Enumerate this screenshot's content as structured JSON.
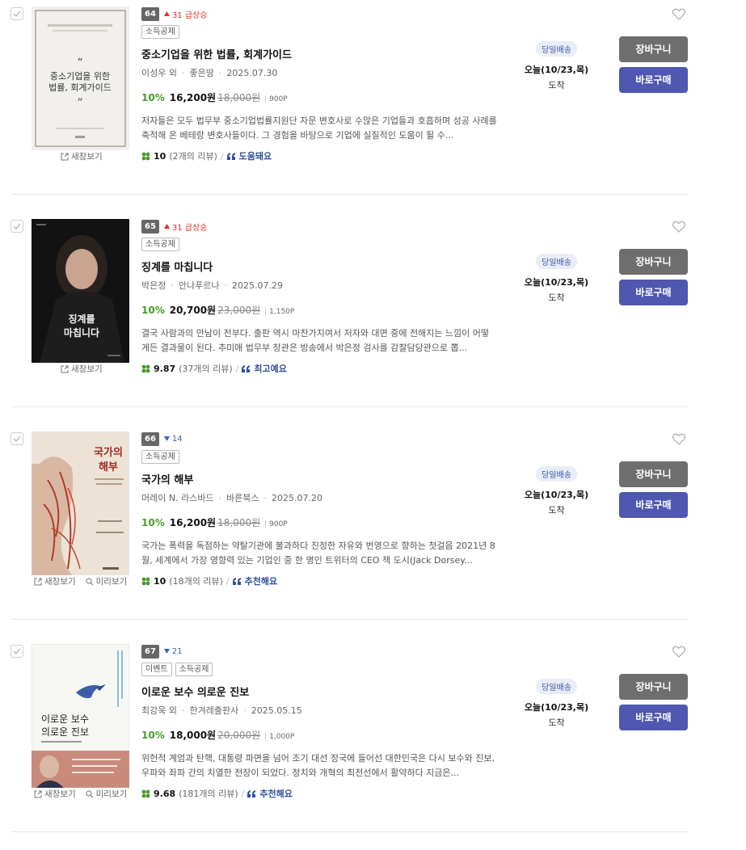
{
  "preview_label": "새창보기",
  "lookinside_label": "미리보기",
  "shipping_badge": "당일배송",
  "delivery_day": "오늘(10/23,목)",
  "delivery_arrive": "도착",
  "cart_label": "장바구니",
  "buy_label": "바로구매",
  "books": [
    {
      "rank": "64",
      "trend": "31 급상승",
      "tags": [
        "소득공제"
      ],
      "title": "중소기업을 위한 법률, 회계가이드",
      "author": "이성우 외",
      "publisher": "좋은땅",
      "date": "2025.07.30",
      "discount": "10%",
      "price": "16,200원",
      "original": "18,000원",
      "points": "900P",
      "desc": "저자들은 모두 법무부 중소기업법률지원단 자문 변호사로 수많은 기업들과 호흡하며 성공 사례를 축적해 온 베테랑 변호사들이다. 그 경험을 바탕으로 기업에 실질적인 도움이 될 수...",
      "score": "10",
      "reviews": "(2개의 리뷰)",
      "keyword": "도움돼요",
      "cover_title_1": "중소기업을 위한",
      "cover_title_2": "법률, 회계가이드",
      "cover_sub": "중소기업법률지원 법무부 자문단 소속 전문가들의 실무 가이드"
    },
    {
      "rank": "65",
      "trend": "31 급상승",
      "tags": [
        "소득공제"
      ],
      "title": "징계를 마칩니다",
      "author": "박은정",
      "publisher": "안나푸르나",
      "date": "2025.07.29",
      "discount": "10%",
      "price": "20,700원",
      "original": "23,000원",
      "points": "1,150P",
      "desc": "결국 사람과의 만남이 전부다. 출판 역시 마찬가지여서 저자와 대면 중에 전해지는 느낌이 어떻게든 결과물이 된다. 추미애 법무부 장관은 방송에서 박은정 검사를 감찰담당관으로 뽑...",
      "score": "9.87",
      "reviews": "(37개의 리뷰)",
      "keyword": "최고예요",
      "cover_title_1": "징계를",
      "cover_title_2": "마칩니다"
    },
    {
      "rank": "66",
      "trend": "14",
      "tags": [
        "소득공제"
      ],
      "title": "국가의 해부",
      "author": "머레이 N. 라스바드",
      "publisher": "바른북스",
      "date": "2025.07.20",
      "discount": "10%",
      "price": "16,200원",
      "original": "18,000원",
      "points": "900P",
      "desc": "국가는 폭력을 독점하는 약탈기관에 불과하다 진정한 자유와 번영으로 향하는 첫걸음 2021년 8월, 세계에서 가장 영향력 있는 기업인 중 한 명인 트위터의 CEO 잭 도시(Jack Dorsey...",
      "score": "10",
      "reviews": "(18개의 리뷰)",
      "keyword": "추천해요",
      "cover_title_1": "국가의",
      "cover_title_2": "해부"
    },
    {
      "rank": "67",
      "trend": "21",
      "tags": [
        "이벤트",
        "소득공제"
      ],
      "title": "이로운 보수 의로운 진보",
      "author": "최강욱 외",
      "publisher": "한겨레출판사",
      "date": "2025.05.15",
      "discount": "10%",
      "price": "18,000원",
      "original": "20,000원",
      "points": "1,000P",
      "desc": "위헌적 계엄과 탄핵, 대통령 파면을 넘어 조기 대선 정국에 들어선 대한민국은 다시 보수와 진보, 우파와 좌파 간의 치열한 전장이 되었다. 정치와 개혁의 최전선에서 활약하다 지금은...",
      "score": "9.68",
      "reviews": "(181개의 리뷰)",
      "keyword": "추천해요",
      "cover_title_1": "이로운 보수",
      "cover_title_2": "의로운 진보"
    }
  ],
  "colors": {
    "discount": "#4a9a2a",
    "buy": "#4f57b0",
    "cart": "#6e6e6e",
    "up": "#e0302b",
    "down": "#3561c8"
  },
  "icons": [
    "checkbox-icon",
    "heart-icon",
    "external-link-icon",
    "magnifier-icon",
    "rating-clover-icon",
    "quote-icon",
    "arrow-up-icon",
    "arrow-down-icon"
  ]
}
